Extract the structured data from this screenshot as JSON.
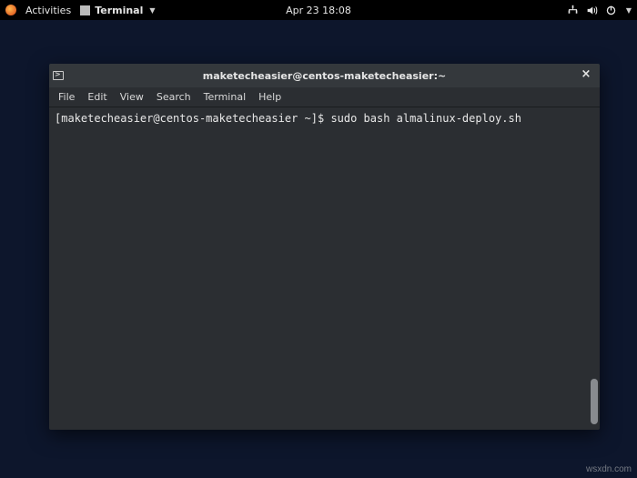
{
  "topbar": {
    "activities": "Activities",
    "app": {
      "label": "Terminal"
    },
    "clock": "Apr 23  18:08"
  },
  "window": {
    "title": "maketecheasier@centos-maketecheasier:~",
    "menubar": [
      "File",
      "Edit",
      "View",
      "Search",
      "Terminal",
      "Help"
    ],
    "close_glyph": "×"
  },
  "terminal": {
    "prompt": "[maketecheasier@centos-maketecheasier ~]$ ",
    "command": "sudo bash almalinux-deploy.sh"
  },
  "watermark": "wsxdn.com"
}
